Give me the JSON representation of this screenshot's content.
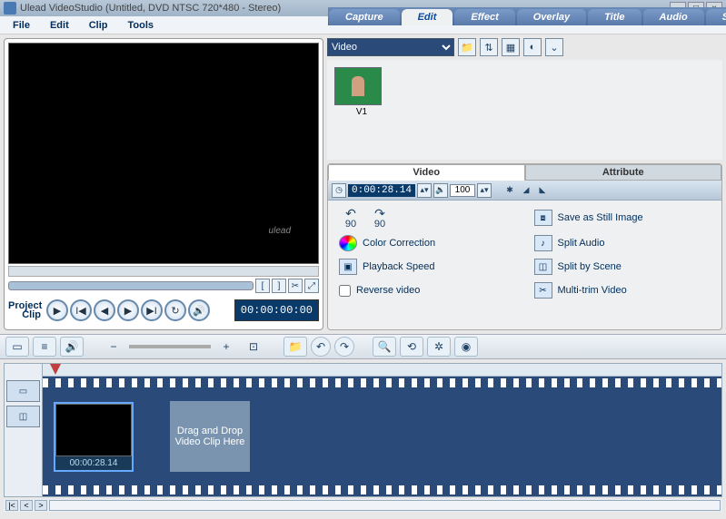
{
  "window": {
    "title": "Ulead VideoStudio (Untitled, DVD NTSC 720*480 - Stereo)"
  },
  "menu": {
    "file": "File",
    "edit": "Edit",
    "clip": "Clip",
    "tools": "Tools"
  },
  "steps": {
    "capture": "Capture",
    "edit": "Edit",
    "effect": "Effect",
    "overlay": "Overlay",
    "title": "Title",
    "audio": "Audio",
    "share": "Share"
  },
  "library": {
    "category": "Video",
    "thumb1": "V1"
  },
  "preview": {
    "watermark": "ulead",
    "project_label": "Project",
    "clip_label": "Clip",
    "timecode": "00:00:00:00"
  },
  "props": {
    "tab_video": "Video",
    "tab_attribute": "Attribute",
    "duration": "0:00:28.14",
    "volume": "100",
    "rot90a": "90",
    "rot90b": "90",
    "color_correction": "Color Correction",
    "playback_speed": "Playback Speed",
    "reverse_video": "Reverse video",
    "save_still": "Save as Still Image",
    "split_audio": "Split Audio",
    "split_scene": "Split by Scene",
    "multitrim": "Multi-trim Video"
  },
  "timeline": {
    "clip_time": "00:00:28.14",
    "dropzone": "Drag and Drop Video Clip Here"
  }
}
